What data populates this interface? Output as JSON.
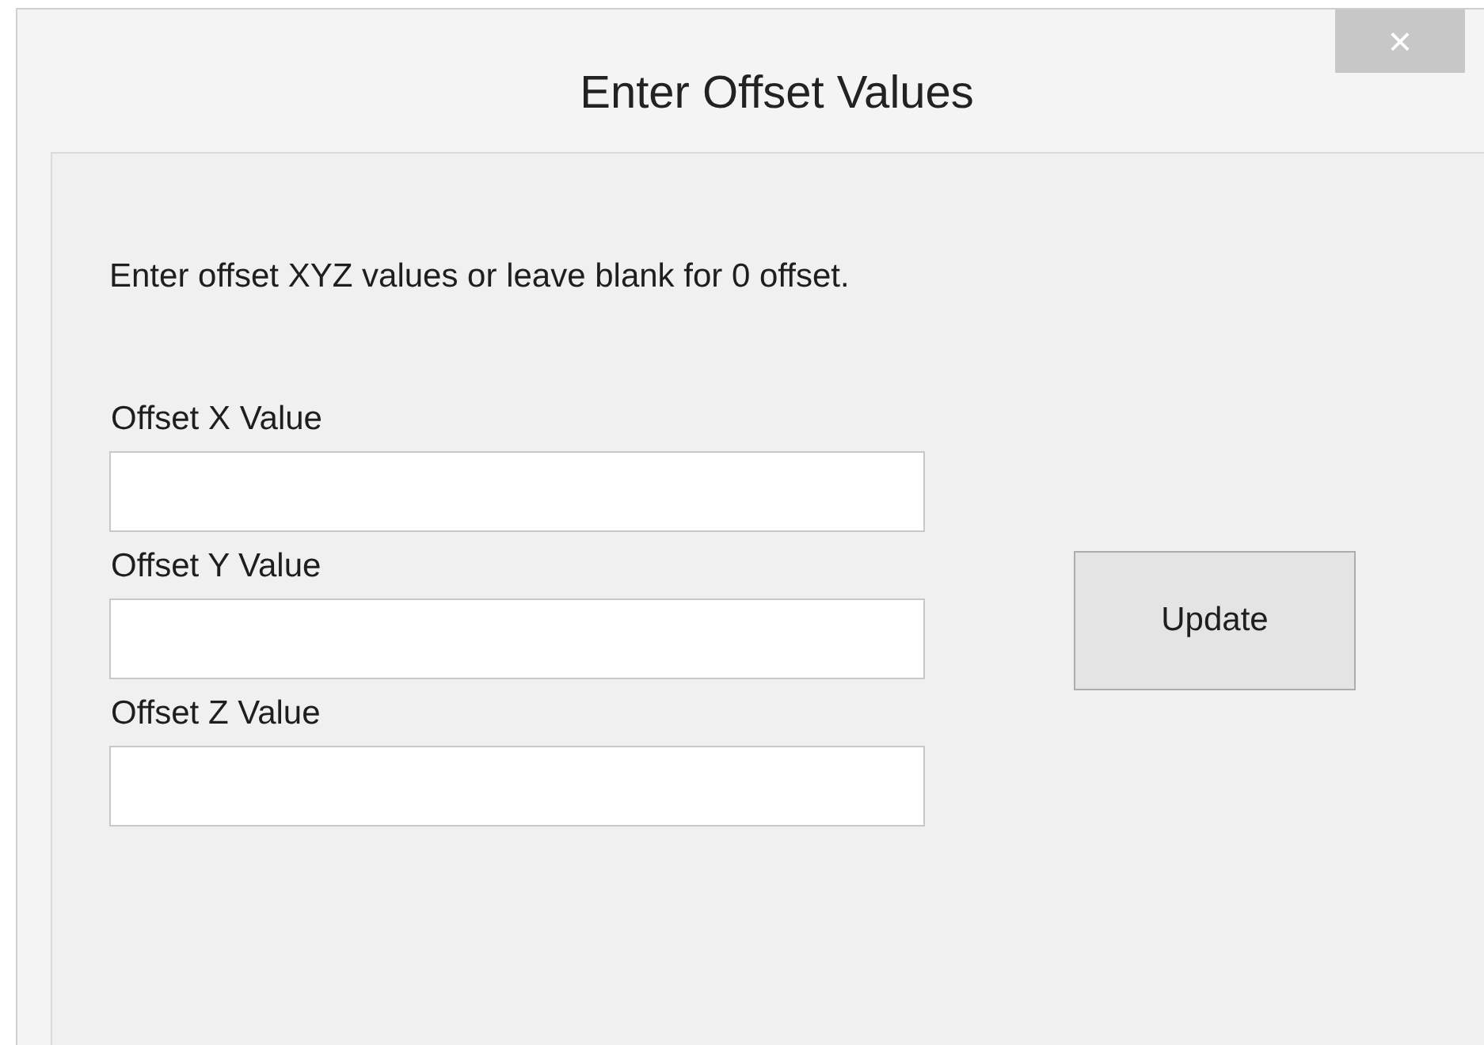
{
  "window": {
    "title": "Enter Offset Values",
    "close": "×"
  },
  "instructions": "Enter offset XYZ values or leave blank for 0 offset.",
  "fields": [
    {
      "label": "Offset X Value"
    },
    {
      "label": "Offset Y Value"
    },
    {
      "label": "Offset Z Value"
    }
  ],
  "buttons": [
    "Update"
  ]
}
